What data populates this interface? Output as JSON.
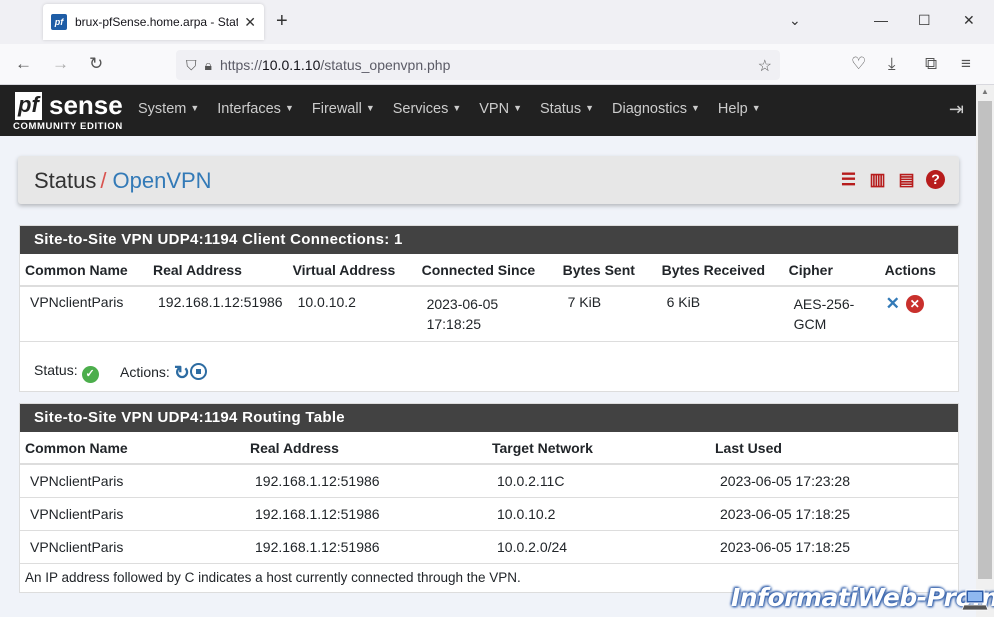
{
  "browser": {
    "tab_title": "brux-pfSense.home.arpa - Status",
    "tab_favicon_text": "pf",
    "url_prefix": "https://",
    "url_host": "10.0.1.10",
    "url_path": "/status_openvpn.php"
  },
  "header": {
    "logo_pf": "pf",
    "logo_sense": "sense",
    "logo_edition": "COMMUNITY EDITION",
    "menu": [
      "System",
      "Interfaces",
      "Firewall",
      "Services",
      "VPN",
      "Status",
      "Diagnostics",
      "Help"
    ]
  },
  "breadcrumb": {
    "status": "Status",
    "separator": "/",
    "page": "OpenVPN"
  },
  "client_panel": {
    "title": "Site-to-Site VPN UDP4:1194 Client Connections: 1",
    "columns": [
      "Common Name",
      "Real Address",
      "Virtual Address",
      "Connected Since",
      "Bytes Sent",
      "Bytes Received",
      "Cipher",
      "Actions"
    ],
    "rows": [
      {
        "common_name": "VPNclientParis",
        "real_address": "192.168.1.12:51986",
        "virtual_address": "10.0.10.2",
        "connected_since_date": "2023-06-05",
        "connected_since_time": "17:18:25",
        "bytes_sent": "7 KiB",
        "bytes_received": "6 KiB",
        "cipher_line1": "AES-256-",
        "cipher_line2": "GCM"
      }
    ],
    "status_label": "Status:",
    "actions_label": "Actions:"
  },
  "routing_panel": {
    "title": "Site-to-Site VPN UDP4:1194 Routing Table",
    "columns": [
      "Common Name",
      "Real Address",
      "Target Network",
      "Last Used"
    ],
    "rows": [
      {
        "common_name": "VPNclientParis",
        "real_address": "192.168.1.12:51986",
        "target_network": "10.0.2.11C",
        "last_used": "2023-06-05 17:23:28"
      },
      {
        "common_name": "VPNclientParis",
        "real_address": "192.168.1.12:51986",
        "target_network": "10.0.10.2",
        "last_used": "2023-06-05 17:18:25"
      },
      {
        "common_name": "VPNclientParis",
        "real_address": "192.168.1.12:51986",
        "target_network": "10.0.2.0/24",
        "last_used": "2023-06-05 17:18:25"
      }
    ],
    "note": "An IP address followed by C indicates a host currently connected through the VPN."
  },
  "watermark": "InformatiWeb-Pro.net",
  "colors": {
    "header_bg": "#212121",
    "panel_heading": "#424242",
    "accent_red": "#b71c1c",
    "link_blue": "#337ab7",
    "status_green": "#4cae4c"
  }
}
